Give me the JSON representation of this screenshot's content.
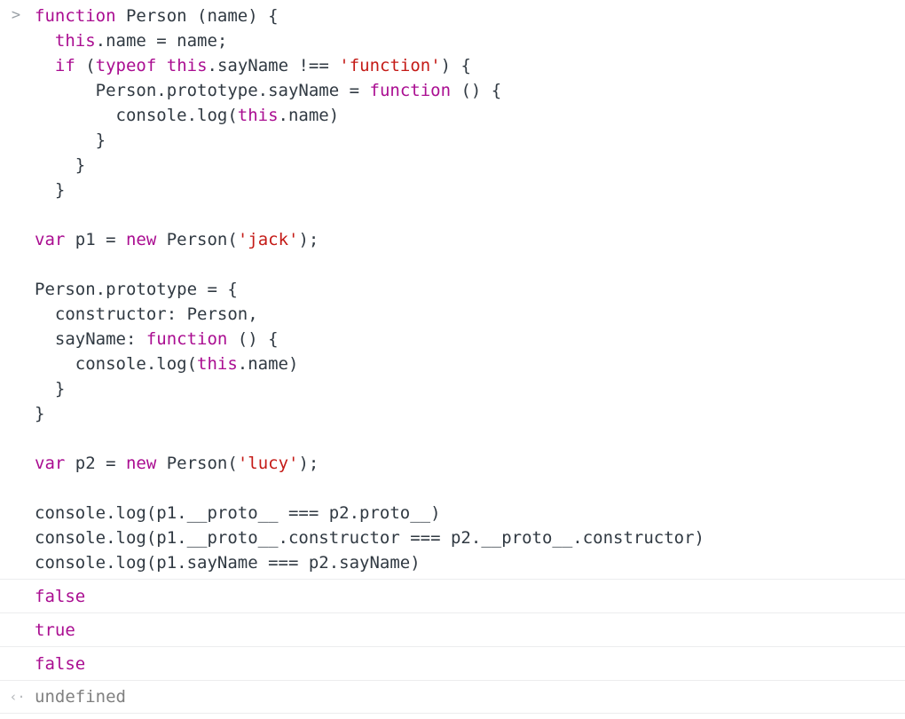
{
  "console": {
    "prompt_symbol": ">",
    "return_symbol": "‹·",
    "colors": {
      "keyword": "#aa0d91",
      "string": "#c41a16",
      "identifier": "#303942",
      "undefined": "#808080",
      "background": "#ffffff",
      "row_separator": "#ecedee",
      "prompt": "#9aa0a6"
    },
    "input_lines": [
      {
        "id": "l1",
        "text": "function Person (name) {",
        "tokens": [
          {
            "t": "function",
            "c": "kw"
          },
          {
            "t": " Person (name) {",
            "c": "plain"
          }
        ]
      },
      {
        "id": "l2",
        "text": "  this.name = name;",
        "tokens": [
          {
            "t": "  ",
            "c": "plain"
          },
          {
            "t": "this",
            "c": "kw"
          },
          {
            "t": ".name = name;",
            "c": "plain"
          }
        ]
      },
      {
        "id": "l3",
        "text": "  if (typeof this.sayName !== 'function') {",
        "tokens": [
          {
            "t": "  ",
            "c": "plain"
          },
          {
            "t": "if",
            "c": "kw"
          },
          {
            "t": " (",
            "c": "plain"
          },
          {
            "t": "typeof",
            "c": "kw"
          },
          {
            "t": " ",
            "c": "plain"
          },
          {
            "t": "this",
            "c": "kw"
          },
          {
            "t": ".sayName !== ",
            "c": "plain"
          },
          {
            "t": "'function'",
            "c": "str"
          },
          {
            "t": ") {",
            "c": "plain"
          }
        ]
      },
      {
        "id": "l4",
        "text": "      Person.prototype.sayName = function () {",
        "tokens": [
          {
            "t": "      Person.prototype.sayName = ",
            "c": "plain"
          },
          {
            "t": "function",
            "c": "kw"
          },
          {
            "t": " () {",
            "c": "plain"
          }
        ]
      },
      {
        "id": "l5",
        "text": "        console.log(this.name)",
        "tokens": [
          {
            "t": "        console.log(",
            "c": "plain"
          },
          {
            "t": "this",
            "c": "kw"
          },
          {
            "t": ".name)",
            "c": "plain"
          }
        ]
      },
      {
        "id": "l6",
        "text": "      }",
        "tokens": [
          {
            "t": "      }",
            "c": "plain"
          }
        ]
      },
      {
        "id": "l7",
        "text": "    }",
        "tokens": [
          {
            "t": "    }",
            "c": "plain"
          }
        ]
      },
      {
        "id": "l8",
        "text": "  }",
        "tokens": [
          {
            "t": "  }",
            "c": "plain"
          }
        ]
      },
      {
        "id": "l9",
        "text": "",
        "tokens": []
      },
      {
        "id": "l10",
        "text": "var p1 = new Person('jack');",
        "tokens": [
          {
            "t": "var",
            "c": "kw"
          },
          {
            "t": " p1 = ",
            "c": "plain"
          },
          {
            "t": "new",
            "c": "kw"
          },
          {
            "t": " Person(",
            "c": "plain"
          },
          {
            "t": "'jack'",
            "c": "str"
          },
          {
            "t": ");",
            "c": "plain"
          }
        ]
      },
      {
        "id": "l11",
        "text": "",
        "tokens": []
      },
      {
        "id": "l12",
        "text": "Person.prototype = {",
        "tokens": [
          {
            "t": "Person.prototype = {",
            "c": "plain"
          }
        ]
      },
      {
        "id": "l13",
        "text": "  constructor: Person,",
        "tokens": [
          {
            "t": "  constructor: Person,",
            "c": "plain"
          }
        ]
      },
      {
        "id": "l14",
        "text": "  sayName: function () {",
        "tokens": [
          {
            "t": "  sayName: ",
            "c": "plain"
          },
          {
            "t": "function",
            "c": "kw"
          },
          {
            "t": " () {",
            "c": "plain"
          }
        ]
      },
      {
        "id": "l15",
        "text": "    console.log(this.name)",
        "tokens": [
          {
            "t": "    console.log(",
            "c": "plain"
          },
          {
            "t": "this",
            "c": "kw"
          },
          {
            "t": ".name)",
            "c": "plain"
          }
        ]
      },
      {
        "id": "l16",
        "text": "  }",
        "tokens": [
          {
            "t": "  }",
            "c": "plain"
          }
        ]
      },
      {
        "id": "l17",
        "text": "}",
        "tokens": [
          {
            "t": "}",
            "c": "plain"
          }
        ]
      },
      {
        "id": "l18",
        "text": "",
        "tokens": []
      },
      {
        "id": "l19",
        "text": "var p2 = new Person('lucy');",
        "tokens": [
          {
            "t": "var",
            "c": "kw"
          },
          {
            "t": " p2 = ",
            "c": "plain"
          },
          {
            "t": "new",
            "c": "kw"
          },
          {
            "t": " Person(",
            "c": "plain"
          },
          {
            "t": "'lucy'",
            "c": "str"
          },
          {
            "t": ");",
            "c": "plain"
          }
        ]
      },
      {
        "id": "l20",
        "text": "",
        "tokens": []
      },
      {
        "id": "l21",
        "text": "console.log(p1.__proto__ === p2.proto__)",
        "tokens": [
          {
            "t": "console.log(p1.__proto__ === p2.proto__)",
            "c": "plain"
          }
        ]
      },
      {
        "id": "l22",
        "text": "console.log(p1.__proto__.constructor === p2.__proto__.constructor)",
        "tokens": [
          {
            "t": "console.log(p1.__proto__.constructor === p2.__proto__.constructor)",
            "c": "plain"
          }
        ]
      },
      {
        "id": "l23",
        "text": "console.log(p1.sayName === p2.sayName)",
        "tokens": [
          {
            "t": "console.log(p1.sayName === p2.sayName)",
            "c": "plain"
          }
        ]
      }
    ],
    "results": [
      {
        "gutter": "",
        "value": "false",
        "kind": "bool"
      },
      {
        "gutter": "",
        "value": "true",
        "kind": "bool"
      },
      {
        "gutter": "",
        "value": "false",
        "kind": "bool"
      },
      {
        "gutter": "‹·",
        "value": "undefined",
        "kind": "undef"
      }
    ]
  }
}
